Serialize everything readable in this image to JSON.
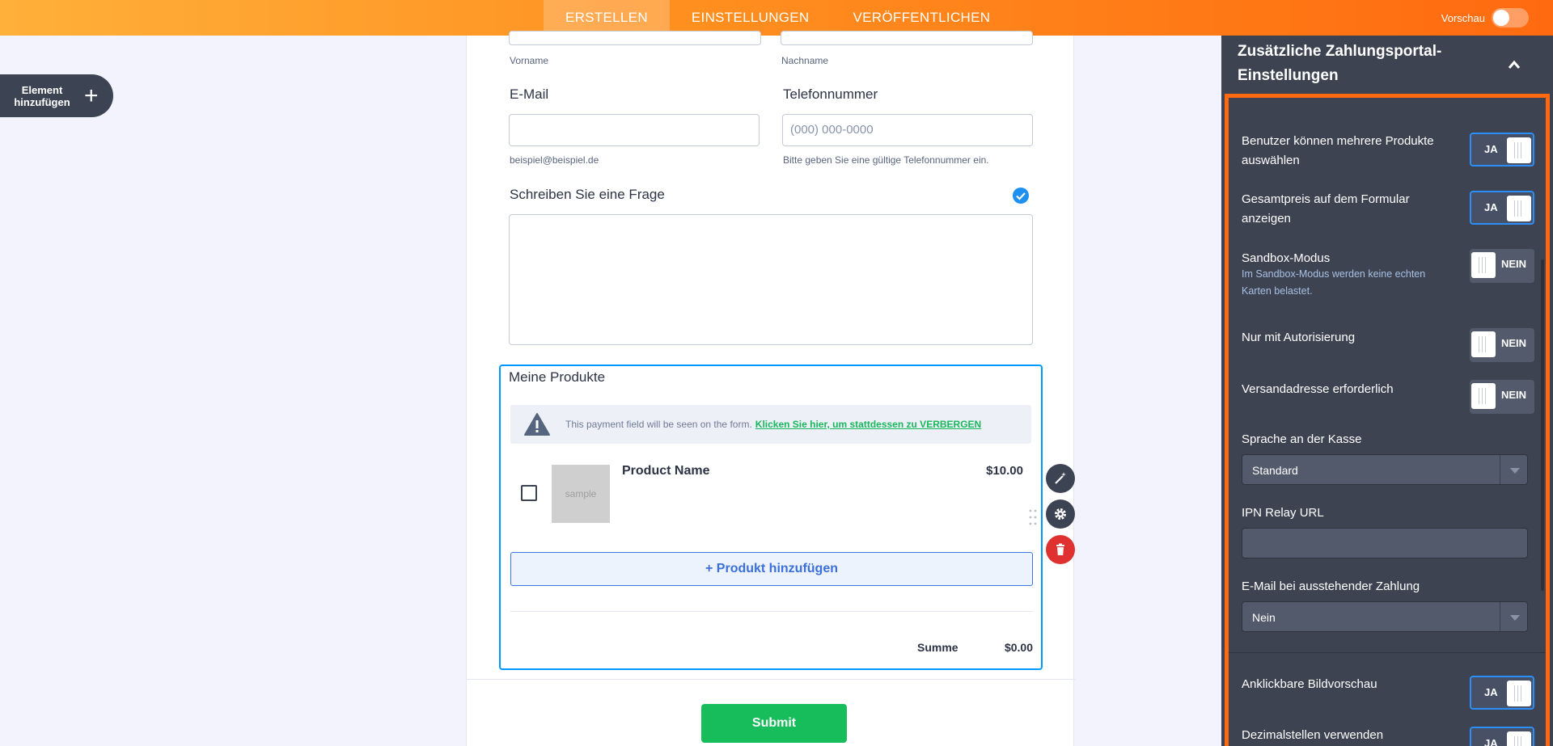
{
  "topbar": {
    "tabs": [
      {
        "label": "ERSTELLEN",
        "active": true
      },
      {
        "label": "EINSTELLUNGEN",
        "active": false
      },
      {
        "label": "VERÖFFENTLICHEN",
        "active": false
      }
    ],
    "preview_label": "Vorschau",
    "preview_on": false
  },
  "add_element": {
    "label_line1": "Element",
    "label_line2": "hinzufügen",
    "icon": "plus-icon"
  },
  "form": {
    "vorname_label": "Vorname",
    "nachname_label": "Nachname",
    "email_label": "E-Mail",
    "email_sublabel": "beispiel@beispiel.de",
    "phone_label": "Telefonnummer",
    "phone_placeholder": "(000) 000-0000",
    "phone_sublabel": "Bitte geben Sie eine gültige Telefonnummer ein.",
    "question_label": "Schreiben Sie eine Frage",
    "products": {
      "title": "Meine Produkte",
      "notice_text": "This payment field will be seen on the form.",
      "notice_link": "Klicken Sie hier, um stattdessen zu VERBERGEN",
      "product_name": "Product Name",
      "product_price": "$10.00",
      "thumbnail_text": "sample",
      "add_product": "+ Produkt hinzufügen",
      "total_label": "Summe",
      "total_value": "$0.00"
    },
    "submit_label": "Submit"
  },
  "panel": {
    "title": "Zusätzliche Zahlungsportal-Einstellungen",
    "settings": [
      {
        "label": "Benutzer können mehrere Produkte auswählen",
        "value": "JA"
      },
      {
        "label": "Gesamtpreis auf dem Formular anzeigen",
        "value": "JA"
      },
      {
        "label": "Sandbox-Modus",
        "sub": "Im Sandbox-Modus werden keine echten Karten belastet.",
        "value": "NEIN"
      },
      {
        "label": "Nur mit Autorisierung",
        "value": "NEIN"
      },
      {
        "label": "Versandadresse erforderlich",
        "value": "NEIN"
      }
    ],
    "checkout_language": {
      "label": "Sprache an der Kasse",
      "value": "Standard"
    },
    "ipn_relay": {
      "label": "IPN Relay URL",
      "value": ""
    },
    "pending_email": {
      "label": "E-Mail bei ausstehender Zahlung",
      "value": "Nein"
    },
    "image_preview": {
      "label": "Anklickbare Bildvorschau",
      "value": "JA"
    },
    "decimals": {
      "label": "Dezimalstellen verwenden",
      "value": "JA"
    }
  },
  "colors": {
    "accent": "#ff6a10",
    "panel_bg": "#3d4351",
    "toggle_on_border": "#2c8ef8",
    "submit": "#18bd5b",
    "selected_border": "#0099ff"
  }
}
